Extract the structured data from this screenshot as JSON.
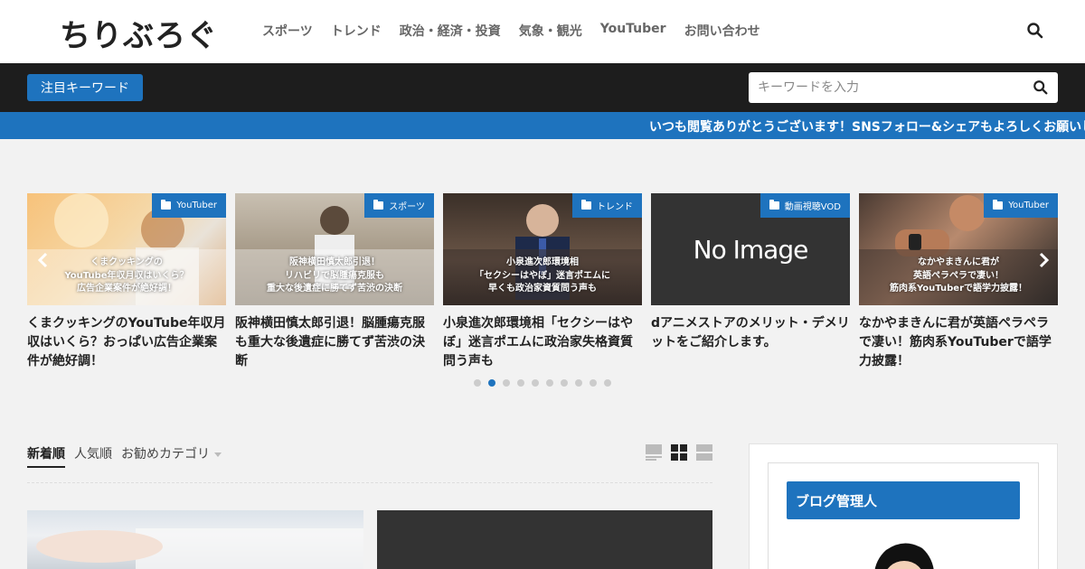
{
  "header": {
    "logo": "ちりぶろぐ",
    "nav": [
      "スポーツ",
      "トレンド",
      "政治・経済・投資",
      "気象・観光",
      "YouTuber",
      "お問い合わせ"
    ]
  },
  "topbar": {
    "keyword_button": "注目キーワード",
    "search_placeholder": "キーワードを入力"
  },
  "ticker": {
    "text": "いつも閲覧ありがとうございます！SNSフォロー&シェアもよろしくお願いします！"
  },
  "slider": {
    "cards": [
      {
        "category": "YouTuber",
        "overlay": [
          "くまクッキングの",
          "YouTube年収月収はいくら？",
          "広告企業案件が絶好調！"
        ],
        "title": "くまクッキングのYouTube年収月収はいくら？おっぱい広告企業案件が絶好調！"
      },
      {
        "category": "スポーツ",
        "overlay": [
          "阪神横田慎太郎引退！",
          "リハビリで脳腫瘍克服も",
          "重大な後遺症に勝てず苦渋の決断"
        ],
        "title": "阪神横田慎太郎引退！脳腫瘍克服も重大な後遺症に勝てず苦渋の決断"
      },
      {
        "category": "トレンド",
        "overlay": [
          "小泉進次郎環境相",
          "「セクシーはやぼ」迷言ポエムに",
          "早くも政治家資質問う声も"
        ],
        "title": "小泉進次郎環境相「セクシーはやぼ」迷言ポエムに政治家失格資質問う声も"
      },
      {
        "category": "動画視聴VOD",
        "noimage": "No Image",
        "title": "dアニメストアのメリット・デメリットをご紹介します。"
      },
      {
        "category": "YouTuber",
        "overlay": [
          "なかやまきんに君が",
          "英語ペラペラで凄い！",
          "筋肉系YouTuberで語学力披露！"
        ],
        "title": "なかやまきんに君が英語ペラペラで凄い！筋肉系YouTuberで語学力披露！"
      }
    ],
    "dot_count": 10,
    "active_dot": 1
  },
  "tabs": {
    "newest": "新着順",
    "popular": "人気順",
    "recommended": "お勧めカテゴリ"
  },
  "sidebar": {
    "title": "ブログ管理人"
  },
  "colors": {
    "accent": "#1e73be",
    "topbar": "#1d1d1d"
  }
}
